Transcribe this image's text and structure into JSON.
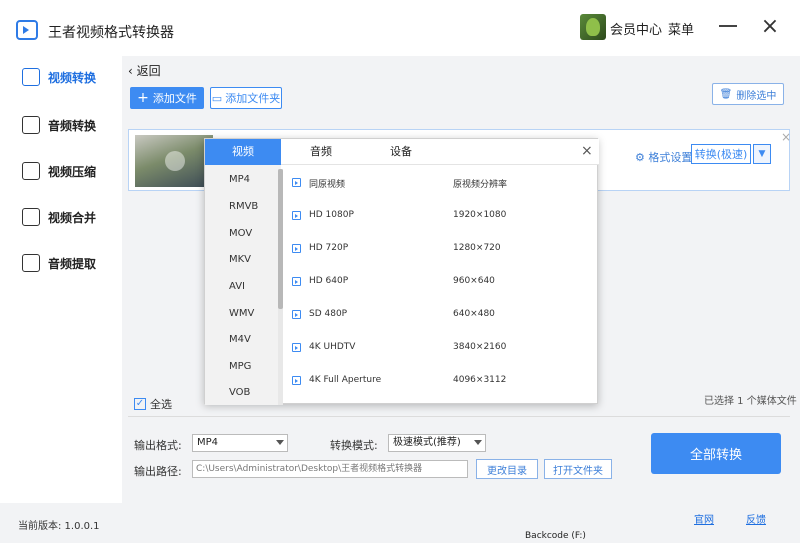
{
  "app": {
    "title": "王者视频格式转换器",
    "member_label": "会员中心",
    "menu_label": "菜单"
  },
  "sidebar": {
    "items": [
      {
        "label": "视频转换",
        "icon": "video-convert-icon",
        "active": true
      },
      {
        "label": "音频转换",
        "icon": "audio-convert-icon",
        "active": false
      },
      {
        "label": "视频压缩",
        "icon": "video-compress-icon",
        "active": false
      },
      {
        "label": "视频合并",
        "icon": "video-merge-icon",
        "active": false
      },
      {
        "label": "音频提取",
        "icon": "audio-extract-icon",
        "active": false
      }
    ]
  },
  "toolbar": {
    "back_label": "返回",
    "add_file_label": "添加文件",
    "add_folder_label": "添加文件夹",
    "delete_selected_label": "删除选中"
  },
  "file_row": {
    "format_settings_label": "格式设置",
    "convert_mode_label": "转换(极速)"
  },
  "format_popup": {
    "tabs": [
      "视频",
      "音频",
      "设备"
    ],
    "formats": [
      "MP4",
      "RMVB",
      "MOV",
      "MKV",
      "AVI",
      "WMV",
      "M4V",
      "MPG",
      "VOB"
    ],
    "presets": [
      {
        "name": "同原视频",
        "resolution": "原视频分辨率"
      },
      {
        "name": "HD 1080P",
        "resolution": "1920×1080"
      },
      {
        "name": "HD 720P",
        "resolution": "1280×720"
      },
      {
        "name": "HD 640P",
        "resolution": "960×640"
      },
      {
        "name": "SD 480P",
        "resolution": "640×480"
      },
      {
        "name": "4K UHDTV",
        "resolution": "3840×2160"
      },
      {
        "name": "4K Full Aperture",
        "resolution": "4096×3112"
      }
    ]
  },
  "list_footer": {
    "select_all_label": "全选",
    "selected_info": "已选择 1 个媒体文件"
  },
  "output": {
    "format_label": "输出格式:",
    "format_value": "MP4",
    "mode_label": "转换模式:",
    "mode_value": "极速模式(推荐)",
    "path_label": "输出路径:",
    "path_value": "C:\\Users\\Administrator\\Desktop\\王者视频格式转换器",
    "change_dir_label": "更改目录",
    "open_folder_label": "打开文件夹",
    "convert_all_label": "全部转换"
  },
  "statusbar": {
    "version_label": "当前版本: 1.0.0.1",
    "website_label": "官网",
    "feedback_label": "反馈",
    "background_text": "Backcode (F:)"
  },
  "colors": {
    "accent": "#3d8bf2",
    "active_text": "#1f6fe0",
    "panel_bg": "#f2f3f5"
  }
}
